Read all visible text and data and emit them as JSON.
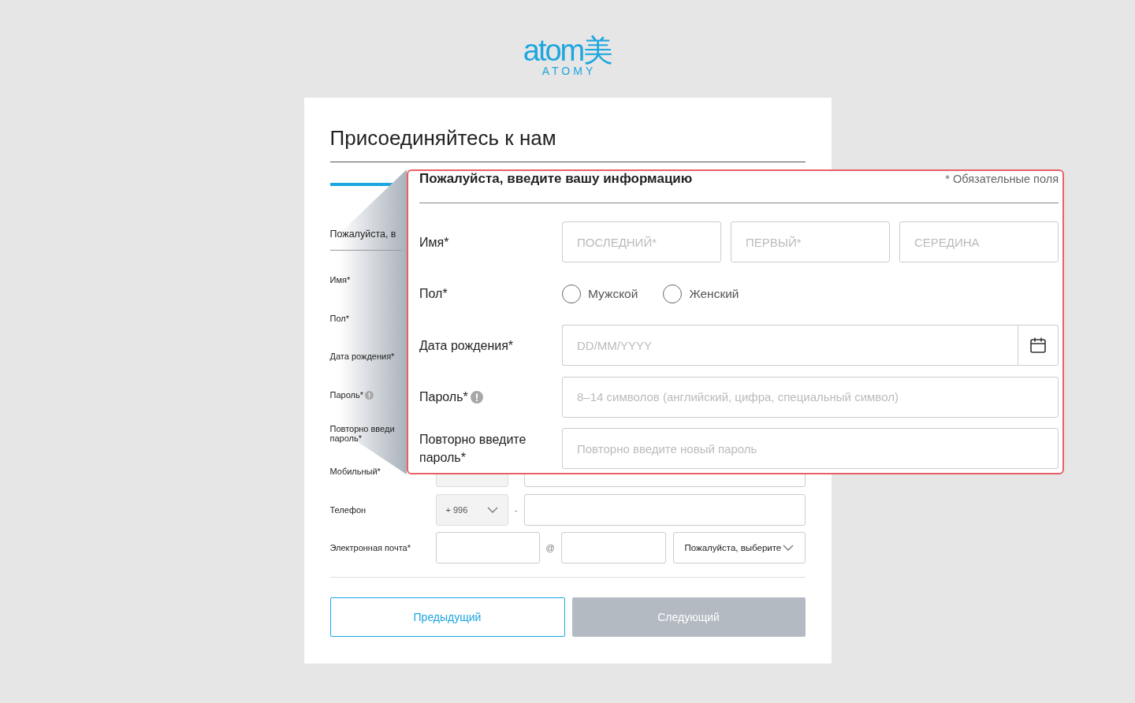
{
  "logo": {
    "wordmark": "atom美",
    "caption": "ATOMY"
  },
  "page_title": "Присоединяйтесь к нам",
  "form": {
    "section_title": "Пожалуйста, в",
    "rows": [
      {
        "label": "Имя*",
        "kind": "label_only"
      },
      {
        "label": "Пол*",
        "kind": "label_only"
      },
      {
        "label": "Дата рождения*",
        "kind": "label_only"
      },
      {
        "label": "Пароль*",
        "kind": "label_only",
        "info": true
      },
      {
        "label": "Повторно введи пароль*",
        "kind": "label_only"
      },
      {
        "label": "Мобильный*",
        "kind": "phone"
      },
      {
        "label": "Телефон",
        "kind": "phone",
        "code": "+ 996",
        "separator": "-"
      },
      {
        "label": "Электронная почта*",
        "kind": "email",
        "at": "@",
        "domain_select": "Пожалуйста, выберите"
      }
    ]
  },
  "buttons": [
    {
      "label": "Предыдущий",
      "disabled": false
    },
    {
      "label": "Следующий",
      "disabled": true
    }
  ],
  "callout": {
    "title": "Пожалуйста, введите вашу информацию",
    "required_note": "* Обязательные поля",
    "rows": [
      {
        "label": "Имя*",
        "kind": "name",
        "fields": [
          {
            "placeholder": "ПОСЛЕДНИЙ*"
          },
          {
            "placeholder": "ПЕРВЫЙ*"
          },
          {
            "placeholder": "СЕРЕДИНА"
          }
        ]
      },
      {
        "label": "Пол*",
        "kind": "radio",
        "options": [
          {
            "label": "Мужской",
            "selected": false
          },
          {
            "label": "Женский",
            "selected": false
          }
        ]
      },
      {
        "label": "Дата рождения*",
        "kind": "date",
        "placeholder": "DD/MM/YYYY"
      },
      {
        "label": "Пароль*",
        "kind": "text",
        "info": true,
        "placeholder": "8–14 символов (английский, цифра, специальный символ)"
      },
      {
        "label": "Повторно введите пароль*",
        "kind": "text",
        "placeholder": "Повторно введите новый пароль"
      }
    ]
  }
}
